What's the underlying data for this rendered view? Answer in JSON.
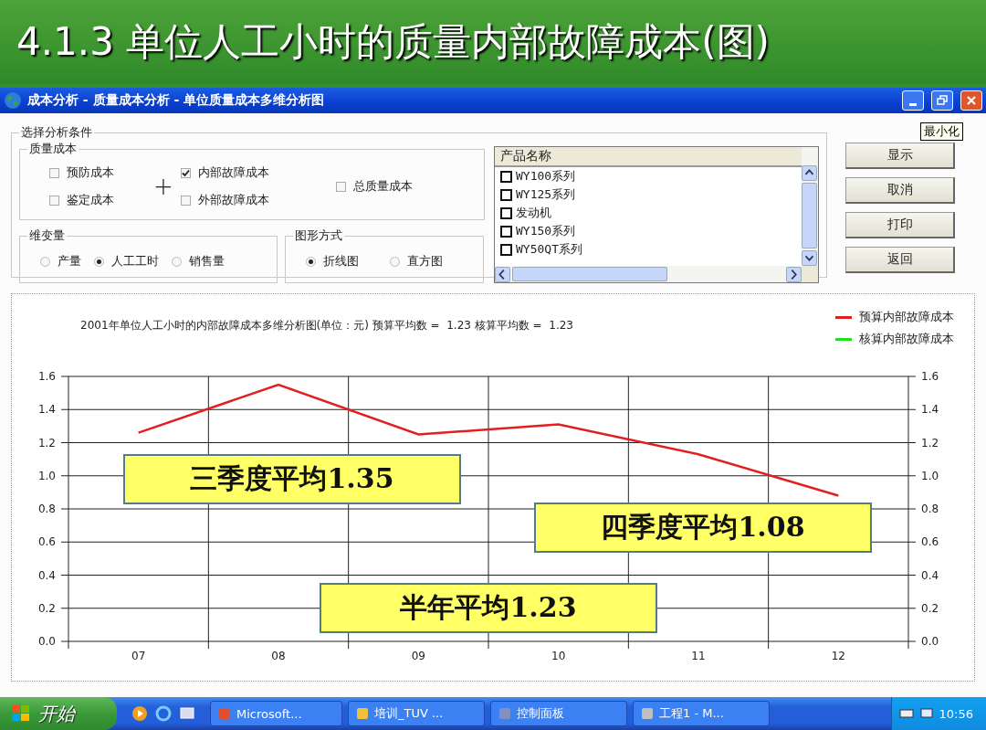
{
  "slide_title": "4.1.3 单位人工小时的质量内部故障成本(图)",
  "window": {
    "title": "成本分析 - 质量成本分析 - 单位质量成本多维分析图",
    "tooltip": "最小化"
  },
  "conditions": {
    "title": "选择分析条件",
    "quality_cost": {
      "title": "质量成本",
      "operator": "+",
      "options": [
        {
          "label": "预防成本",
          "checked": false
        },
        {
          "label": "鉴定成本",
          "checked": false
        },
        {
          "label": "内部故障成本",
          "checked": true
        },
        {
          "label": "外部故障成本",
          "checked": false
        },
        {
          "label": "总质量成本",
          "checked": false
        }
      ]
    },
    "dimension": {
      "title": "维变量",
      "options": [
        {
          "label": "产量",
          "selected": false
        },
        {
          "label": "人工工时",
          "selected": true
        },
        {
          "label": "销售量",
          "selected": false
        }
      ]
    },
    "chart_type": {
      "title": "图形方式",
      "options": [
        {
          "label": "折线图",
          "selected": true
        },
        {
          "label": "直方图",
          "selected": false
        }
      ]
    }
  },
  "products": {
    "header": "产品名称",
    "items": [
      {
        "label": "WY100系列",
        "checked": false
      },
      {
        "label": "WY125系列",
        "checked": false
      },
      {
        "label": "发动机",
        "checked": false
      },
      {
        "label": "WY150系列",
        "checked": false
      },
      {
        "label": "WY50QT系列",
        "checked": false
      }
    ]
  },
  "buttons": [
    "显示",
    "取消",
    "打印",
    "返回"
  ],
  "chart": {
    "chart_data": {
      "type": "line",
      "title": "2001年单位人工小时的内部故障成本多维分析图(单位：元) 预算平均数 =  1.23 核算平均数 =  1.23",
      "categories": [
        "07",
        "08",
        "09",
        "10",
        "11",
        "12"
      ],
      "series": [
        {
          "name": "预算内部故障成本",
          "color": "#e02020",
          "values": [
            1.26,
            1.55,
            1.25,
            1.31,
            1.13,
            0.88
          ]
        },
        {
          "name": "核算内部故障成本",
          "color": "#20e020",
          "values": [
            null,
            null,
            null,
            null,
            null,
            null
          ]
        }
      ],
      "grid": true,
      "ylim": [
        0,
        1.6
      ],
      "yticks": [
        {
          "value": 0,
          "label": "0.0"
        },
        {
          "value": 0.2,
          "label": "0.2"
        },
        {
          "value": 0.4,
          "label": "0.4"
        },
        {
          "value": 0.6,
          "label": "0.6"
        },
        {
          "value": 0.8,
          "label": "0.8"
        },
        {
          "value": 1,
          "label": "1.0"
        },
        {
          "value": 1.2,
          "label": "1.2"
        },
        {
          "value": 1.4,
          "label": "1.4"
        },
        {
          "value": 1.6,
          "label": "1.6"
        }
      ]
    },
    "callouts": [
      {
        "text": "三季度平均1.35"
      },
      {
        "text": "四季度平均1.08"
      },
      {
        "text": "半年平均1.23"
      }
    ]
  },
  "taskbar": {
    "start": "开始",
    "tasks": [
      {
        "label": "Microsoft...",
        "selected": false
      },
      {
        "label": "培训_TUV ...",
        "selected": false
      },
      {
        "label": "控制面板",
        "selected": false
      },
      {
        "label": "工程1 - M...",
        "selected": false
      }
    ],
    "clock": "10:56"
  }
}
